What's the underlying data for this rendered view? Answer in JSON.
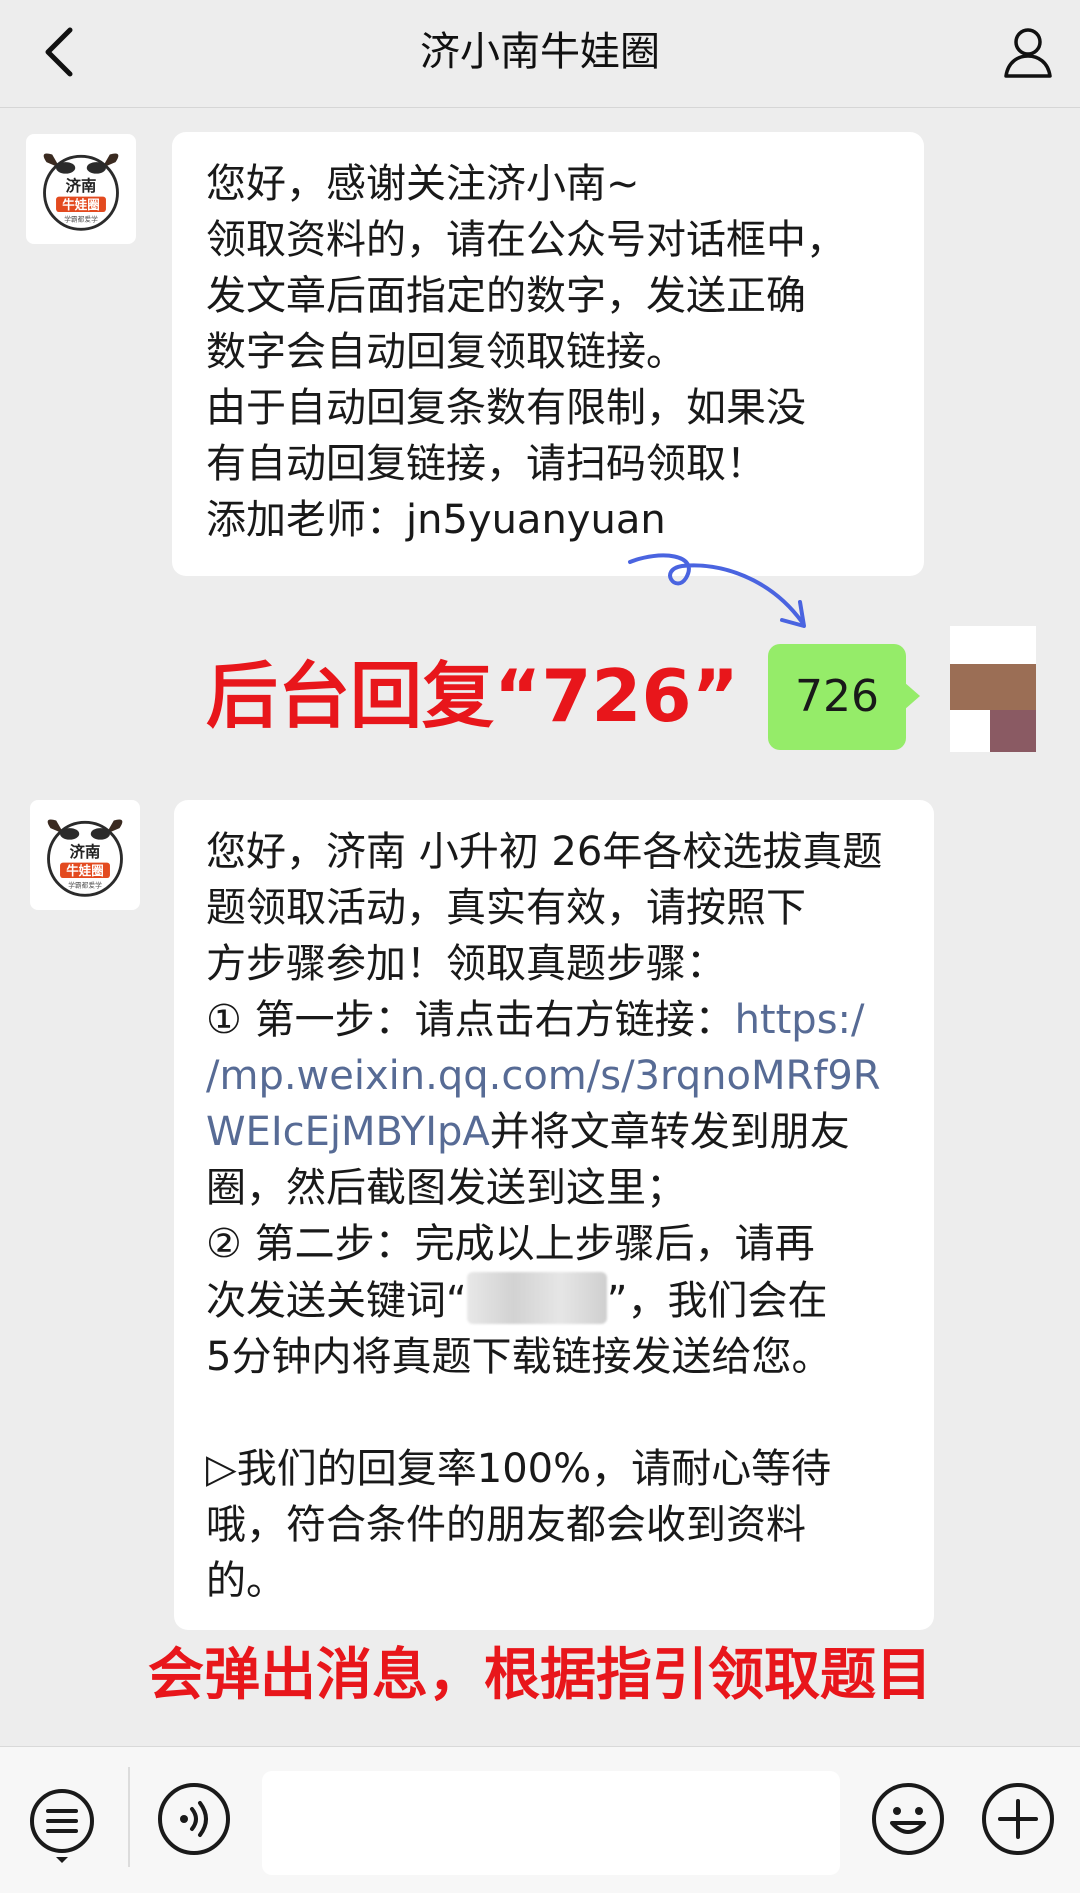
{
  "header": {
    "title": "济小南牛娃圈",
    "back_icon": "chevron-left-icon",
    "profile_icon": "person-icon"
  },
  "avatar": {
    "logo_text_top": "济南",
    "logo_text_mid": "牛娃圈",
    "logo_text_bottom": "学霸都爱学"
  },
  "messages": [
    {
      "sender": "official-account",
      "lines": [
        "您好，感谢关注济小南~",
        "领取资料的，请在公众号对话框中，",
        "发文章后面指定的数字，发送正确",
        "数字会自动回复领取链接。",
        "由于自动回复条数有限制，如果没",
        "有自动回复链接，请扫码领取！",
        "添加老师：jn5yuanyuan"
      ]
    },
    {
      "sender": "me",
      "text": "726"
    },
    {
      "sender": "official-account",
      "line_1": "您好，济南 小升初 26年各校选拔真题",
      "line_2": "题领取活动，真实有效，请按照下",
      "line_3": "方步骤参加！领取真题步骤：",
      "line_4_prefix": "① 第一步：请点击右方链接：",
      "line_4_link": "https:/",
      "line_5_link": "/mp.weixin.qq.com/s/3rqnoMRf9R",
      "line_6_link": "WEIcEjMBYIpA",
      "line_6_suffix": "并将文章转发到朋友",
      "line_7": "圈，然后截图发送到这里；",
      "line_8": "② 第二步：完成以上步骤后，请再",
      "line_9_prefix": "次发送关键词“",
      "line_9_suffix": "”，我们会在",
      "line_10": "5分钟内将真题下载链接发送给您。",
      "line_11": "▷我们的回复率100%，请耐心等待",
      "line_12": "哦，符合条件的朋友都会收到资料",
      "line_13": "的。"
    }
  ],
  "annotations": {
    "reply_hint": "后台回复“726”",
    "popup_hint": "会弹出消息，根据指引领取题目",
    "color": "#e8161b"
  },
  "colors": {
    "background": "#ededed",
    "sent_bubble": "#95ec69",
    "link": "#576b95",
    "arrow": "#4a64e0"
  },
  "bottom_bar": {
    "menu_icon": "list-menu-icon",
    "voice_icon": "voice-icon",
    "emoji_icon": "smiley-icon",
    "plus_icon": "plus-circle-icon",
    "input_placeholder": ""
  }
}
